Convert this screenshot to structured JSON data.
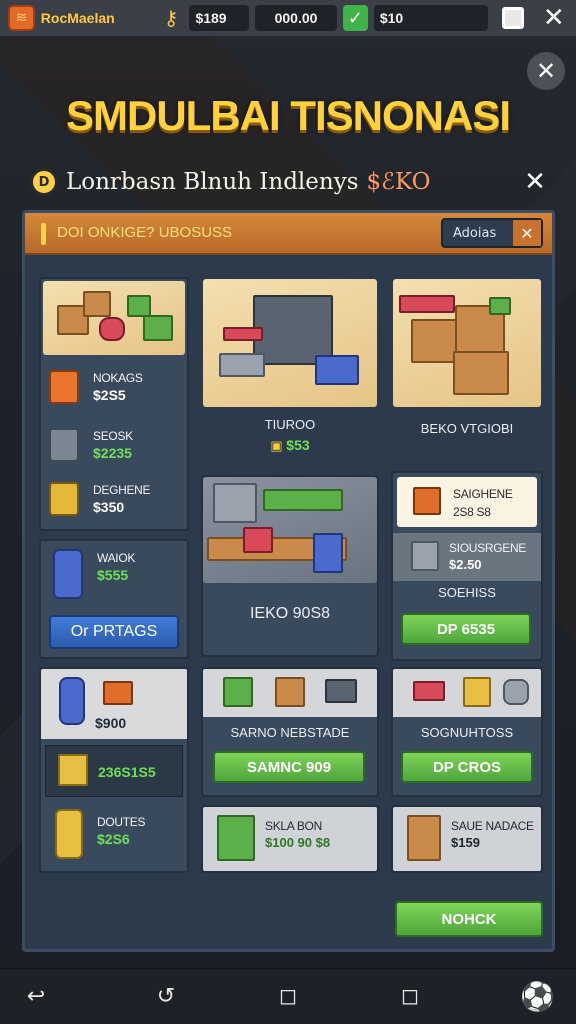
{
  "topbar": {
    "logo_glyph": "≋",
    "title": "RocMaelan",
    "key_glyph": "⚷",
    "currency_1": "$189",
    "currency_2": "000.00",
    "check_glyph": "✓",
    "currency_3": "$10",
    "close_glyph": "✕"
  },
  "overlay": {
    "close_glyph": "✕",
    "title": "SMDULBAI TISNONASI",
    "subtitle_icon_glyph": "D",
    "subtitle_text": "Lonrbasn Blnuh Indlenys",
    "subtitle_price": "$ℰKO",
    "subtitle_close_glyph": "✕"
  },
  "panel": {
    "header_text": "DOI ONKIGE? UBOSUSS",
    "header_button_label": "Adoias",
    "header_button_close_glyph": "✕",
    "left_column": {
      "rows": [
        {
          "label": "NOKAGS",
          "price": "$2S5",
          "green": false
        },
        {
          "label": "SEOSK",
          "price": "$2235",
          "green": true
        },
        {
          "label": "DEGHENE",
          "price": "$350",
          "green": false
        }
      ]
    },
    "store_card": {
      "label": "TIUROO",
      "price": "$53"
    },
    "boxes_card": {
      "label": "BEKO VTGIOBI"
    },
    "shelves_card": {
      "label": "IEKO 90S8"
    },
    "side_card": {
      "top_label": "SAIGHENE",
      "top_price": "2S8 S8",
      "item_label": "SIOUSRGENE",
      "item_price": "$2.50",
      "bottom_label": "SOEHISS",
      "button_label": "DP 6535"
    },
    "can_card": {
      "label": "WAIOK",
      "price": "$555",
      "button_label": "Or PRTAGS"
    },
    "left_lower": {
      "price_1": "$900",
      "price_2": "236S1S5",
      "label_3": "DOUTES",
      "price_3": "$2S6"
    },
    "mid_lower": {
      "label": "SARNO NEBSTADE",
      "button_label": "SAMNC 909"
    },
    "right_lower": {
      "label": "SOGNUHTOSS",
      "button_label": "DP CROS"
    },
    "mid_bottom": {
      "label": "SKLA BON",
      "price": "$100 90 $8"
    },
    "right_bottom": {
      "label": "SAUE NADACE",
      "price": "$159"
    },
    "footer_button_label": "NOHCK"
  },
  "navbar": {
    "back_glyph": "↩",
    "recent_glyph": "↺",
    "home_glyph": "◻",
    "tasks_glyph": "◻",
    "ball_glyph": "⚽"
  }
}
